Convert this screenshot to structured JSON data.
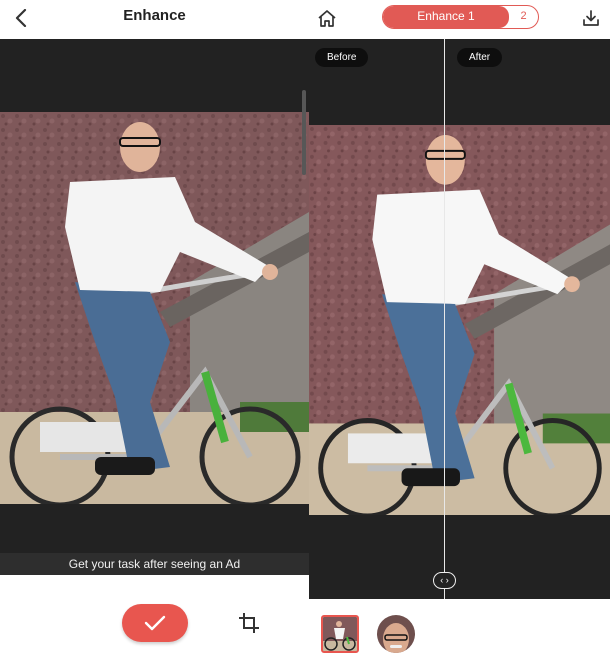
{
  "left": {
    "header": {
      "title": "Enhance"
    },
    "ad_text": "Get your task after seeing an Ad"
  },
  "right": {
    "tabs": [
      {
        "label": "Enhance 1",
        "active": true
      },
      {
        "label": "2",
        "active": false
      }
    ],
    "compare": {
      "before_label": "Before",
      "after_label": "After",
      "handle_glyph": "‹ ›"
    }
  },
  "icons": {
    "back": "chevron-left-icon",
    "home": "home-icon",
    "download": "download-icon",
    "confirm": "checkmark-icon",
    "crop": "crop-icon"
  },
  "colors": {
    "accent": "#e8564f",
    "dark_bg": "#222222",
    "ad_strip": "#2e2e2e"
  }
}
